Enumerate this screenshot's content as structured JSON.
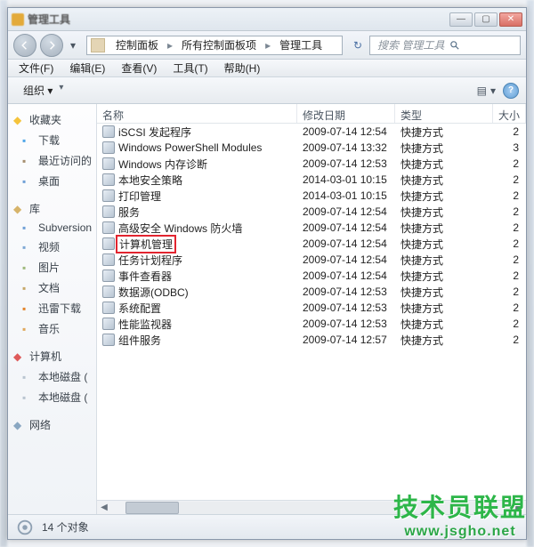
{
  "title_blur": "管理工具",
  "winbtns": {
    "min": "—",
    "max": "▢",
    "close": "✕"
  },
  "nav": {
    "back": "←",
    "fwd": "→",
    "drop": "▾",
    "crumbs": [
      "控制面板",
      "所有控制面板项",
      "管理工具"
    ],
    "chev": "▸",
    "search_placeholder": "搜索 管理工具",
    "refresh": "↻"
  },
  "menu": [
    {
      "label": "文件(F)"
    },
    {
      "label": "编辑(E)"
    },
    {
      "label": "查看(V)"
    },
    {
      "label": "工具(T)"
    },
    {
      "label": "帮助(H)"
    }
  ],
  "toolbar": {
    "organize": "组织 ▾",
    "view_icon": "▤",
    "view_drop": "▾",
    "help": "?"
  },
  "sidebar": {
    "favorites": {
      "label": "收藏夹",
      "items": [
        {
          "icon": "ic-down",
          "label": "下载"
        },
        {
          "icon": "ic-clock",
          "label": "最近访问的"
        },
        {
          "icon": "ic-desk",
          "label": "桌面"
        }
      ]
    },
    "libraries": {
      "label": "库",
      "items": [
        {
          "icon": "ic-svn",
          "label": "Subversion"
        },
        {
          "icon": "ic-video",
          "label": "视频"
        },
        {
          "icon": "ic-pic",
          "label": "图片"
        },
        {
          "icon": "ic-doc",
          "label": "文档"
        },
        {
          "icon": "ic-xl",
          "label": "迅雷下载"
        },
        {
          "icon": "ic-music",
          "label": "音乐"
        }
      ]
    },
    "computer": {
      "label": "计算机",
      "items": [
        {
          "icon": "ic-disk",
          "label": "本地磁盘 ("
        },
        {
          "icon": "ic-disk",
          "label": "本地磁盘 ("
        }
      ]
    },
    "network": {
      "label": "网络",
      "items": []
    }
  },
  "columns": {
    "name": "名称",
    "date": "修改日期",
    "type": "类型",
    "size": "大小"
  },
  "files": [
    {
      "name": "iSCSI 发起程序",
      "date": "2009-07-14 12:54",
      "type": "快捷方式",
      "size": "2"
    },
    {
      "name": "Windows PowerShell Modules",
      "date": "2009-07-14 13:32",
      "type": "快捷方式",
      "size": "3"
    },
    {
      "name": "Windows 内存诊断",
      "date": "2009-07-14 12:53",
      "type": "快捷方式",
      "size": "2"
    },
    {
      "name": "本地安全策略",
      "date": "2014-03-01 10:15",
      "type": "快捷方式",
      "size": "2"
    },
    {
      "name": "打印管理",
      "date": "2014-03-01 10:15",
      "type": "快捷方式",
      "size": "2"
    },
    {
      "name": "服务",
      "date": "2009-07-14 12:54",
      "type": "快捷方式",
      "size": "2"
    },
    {
      "name": "高级安全 Windows 防火墙",
      "date": "2009-07-14 12:54",
      "type": "快捷方式",
      "size": "2"
    },
    {
      "name": "计算机管理",
      "date": "2009-07-14 12:54",
      "type": "快捷方式",
      "size": "2",
      "highlight": true
    },
    {
      "name": "任务计划程序",
      "date": "2009-07-14 12:54",
      "type": "快捷方式",
      "size": "2"
    },
    {
      "name": "事件查看器",
      "date": "2009-07-14 12:54",
      "type": "快捷方式",
      "size": "2"
    },
    {
      "name": "数据源(ODBC)",
      "date": "2009-07-14 12:53",
      "type": "快捷方式",
      "size": "2"
    },
    {
      "name": "系统配置",
      "date": "2009-07-14 12:53",
      "type": "快捷方式",
      "size": "2"
    },
    {
      "name": "性能监视器",
      "date": "2009-07-14 12:53",
      "type": "快捷方式",
      "size": "2"
    },
    {
      "name": "组件服务",
      "date": "2009-07-14 12:57",
      "type": "快捷方式",
      "size": "2"
    }
  ],
  "status": {
    "count": "14 个对象"
  },
  "watermark": {
    "big": "技术员联盟",
    "url": "www.jsgho.net"
  }
}
